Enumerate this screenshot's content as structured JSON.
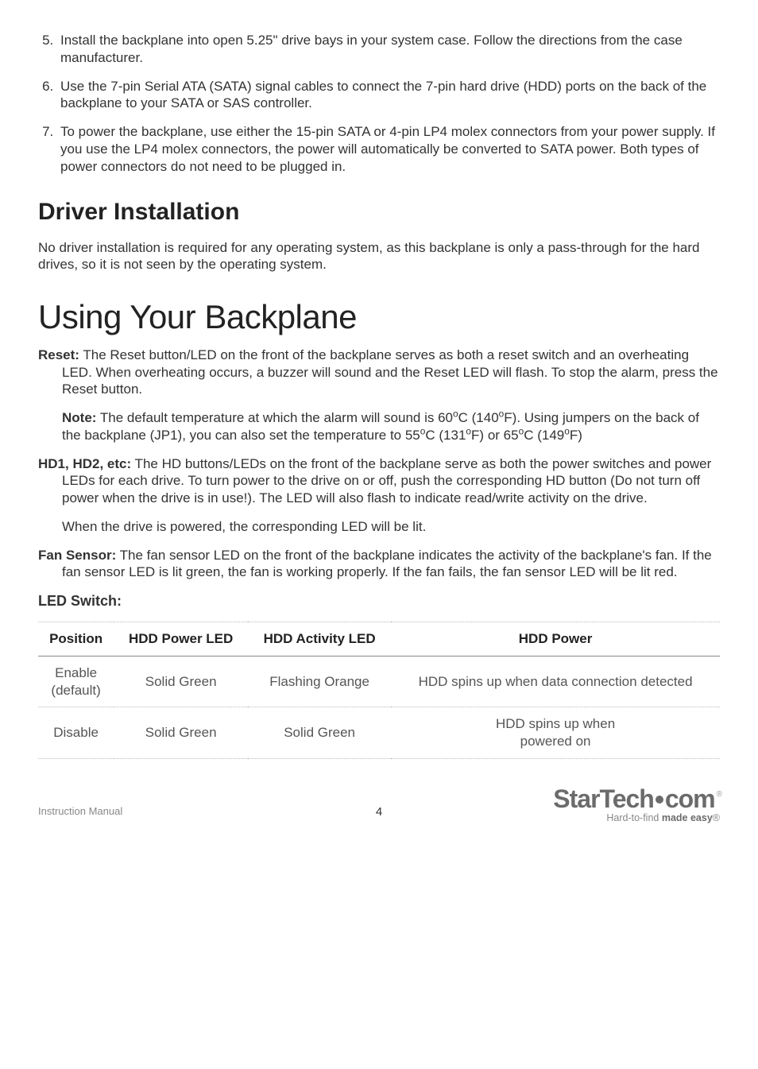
{
  "list": {
    "item5": "Install the backplane into open 5.25\" drive bays in your system case.  Follow the directions from the case manufacturer.",
    "item6": "Use the 7-pin Serial ATA (SATA) signal cables to connect the 7-pin hard drive (HDD) ports on the back of the backplane to your SATA or SAS controller.",
    "item7": "To power the backplane, use either the 15-pin SATA or 4-pin LP4 molex connectors from your power supply. If you use the LP4 molex connectors, the power will automatically be converted to SATA power.  Both types of power connectors do not need to be plugged in."
  },
  "section1_title": "Driver Installation",
  "section1_body": "No driver installation is required for any operating system, as this backplane is only a pass-through for the hard drives, so it is not seen by the operating system.",
  "major_title": "Using Your Backplane",
  "reset_label": "Reset:",
  "reset_body": " The Reset button/LED on the front of the backplane serves as both a reset switch and an overheating LED. When overheating occurs, a buzzer will sound and the Reset LED will flash. To stop the alarm, press the Reset button.",
  "note_label": "Note:",
  "note_body_a": " The default temperature at which the alarm will sound is 60",
  "note_body_b": "C (140",
  "note_body_c": "F). Using jumpers on the back of the backplane (JP1), you can also set the temperature to 55",
  "note_body_d": "C (131",
  "note_body_e": "F) or 65",
  "note_body_f": "C (149",
  "note_body_g": "F)",
  "deg": "o",
  "hd_label": "HD1, HD2, etc:",
  "hd_body": " The HD buttons/LEDs on the front of the backplane serve as both the power switches and power LEDs for each drive. To turn power to the drive on or off, push the corresponding HD button (Do not turn off power when the drive is in use!). The LED will also flash to indicate read/write activity on the drive.",
  "hd_note": "When the drive is powered, the corresponding LED will be lit.",
  "fan_label": "Fan Sensor:",
  "fan_body": " The fan sensor LED on the front of the backplane indicates the activity of the backplane's fan. If the fan sensor LED is lit green, the fan is working properly. If the fan fails, the fan sensor LED will be lit red.",
  "led_switch_head": "LED Switch:",
  "table": {
    "h1": "Position",
    "h2": "HDD Power LED",
    "h3": "HDD Activity LED",
    "h4": "HDD Power",
    "r1c1a": "Enable",
    "r1c1b": "(default)",
    "r1c2": "Solid Green",
    "r1c3": "Flashing Orange",
    "r1c4": "HDD spins up when data connection detected",
    "r2c1": "Disable",
    "r2c2": "Solid Green",
    "r2c3": "Solid Green",
    "r2c4a": "HDD spins up when",
    "r2c4b": "powered on"
  },
  "footer_left": "Instruction Manual",
  "page_num": "4",
  "brand_a": "StarTech",
  "brand_b": "com",
  "tagline_a": "Hard-to-find ",
  "tagline_b": "made easy",
  "tm": "®"
}
